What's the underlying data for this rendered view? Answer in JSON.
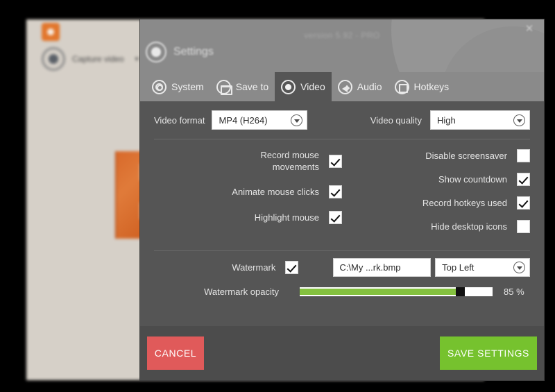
{
  "background_app": {
    "logo_icon": "app-logo-orange",
    "capture_label": "Capture video",
    "caret_icon": "chevron-down-icon"
  },
  "dialog": {
    "version_text": "version 5.92  -  PRO",
    "title": "Settings",
    "title_icon": "record-circle-icon",
    "close_icon": "close-icon",
    "tabs": [
      {
        "label": "System",
        "icon": "gears-icon",
        "active": false
      },
      {
        "label": "Save to",
        "icon": "folder-icon",
        "active": false
      },
      {
        "label": "Video",
        "icon": "record-icon",
        "active": true
      },
      {
        "label": "Audio",
        "icon": "speaker-icon",
        "active": false
      },
      {
        "label": "Hotkeys",
        "icon": "keyboard-key-icon",
        "active": false
      }
    ],
    "video": {
      "format_label": "Video format",
      "format_value": "MP4 (H264)",
      "quality_label": "Video quality",
      "quality_value": "High",
      "options_left": [
        {
          "label": "Record mouse movements",
          "checked": true
        },
        {
          "label": "Animate mouse clicks",
          "checked": true
        },
        {
          "label": "Highlight mouse",
          "checked": true
        }
      ],
      "options_right": [
        {
          "label": "Disable screensaver",
          "checked": false
        },
        {
          "label": "Show countdown",
          "checked": true
        },
        {
          "label": "Record hotkeys used",
          "checked": true
        },
        {
          "label": "Hide desktop icons",
          "checked": false
        }
      ],
      "watermark_label": "Watermark",
      "watermark_checked": true,
      "watermark_path": "C:\\My ...rk.bmp",
      "watermark_position": "Top Left",
      "opacity_label": "Watermark opacity",
      "opacity_percent": 85,
      "opacity_value_text": "85 %"
    },
    "footer": {
      "cancel_label": "CANCEL",
      "save_label": "SAVE SETTINGS"
    }
  },
  "colors": {
    "header_gray": "#8a8a8a",
    "body_gray": "#555555",
    "footer_gray": "#4c4c4c",
    "cancel_red": "#e05a5a",
    "save_green": "#76c22e",
    "slider_green": "#84c13f",
    "accent_orange": "#e2762c"
  }
}
